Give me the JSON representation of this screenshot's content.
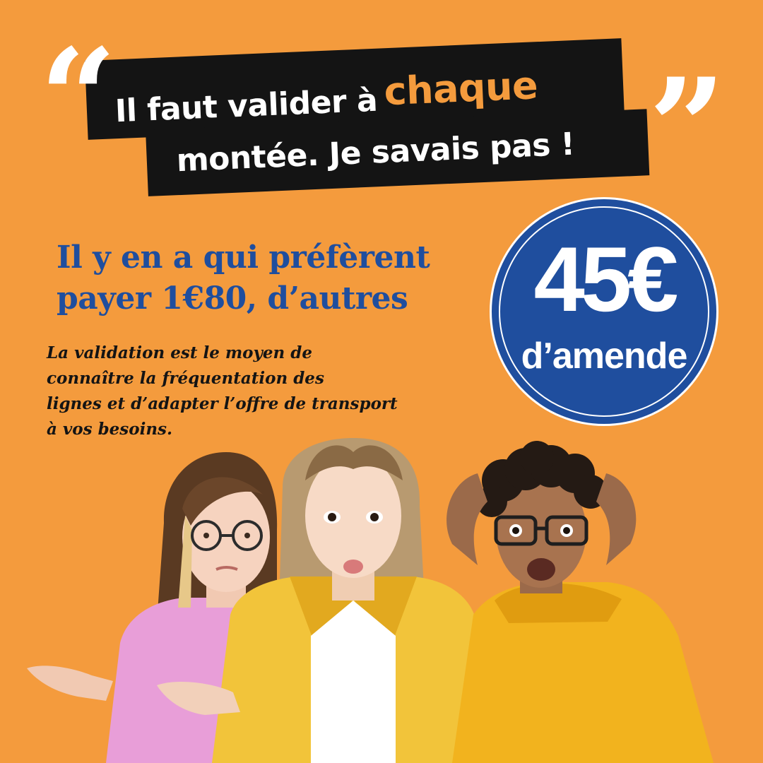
{
  "quote": {
    "open_mark": "“",
    "close_mark": "”",
    "line1_prefix": "Il faut valider à",
    "line1_highlight": "chaque",
    "line2": "montée. Je savais pas !"
  },
  "heading": {
    "line1": "Il y en a qui préfèrent",
    "line2": "payer 1€80, d’autres"
  },
  "body": {
    "line1": "La validation est le moyen de",
    "line2": "connaître la fréquentation des",
    "line3": "lignes et d’adapter l’offre de transport",
    "line4": "à vos besoins."
  },
  "badge": {
    "amount": "45€",
    "label": "d’amende"
  },
  "colors": {
    "background": "#f49b3d",
    "strip": "#141414",
    "accent_orange": "#f49b3d",
    "blue": "#1f4e9e",
    "white": "#ffffff",
    "text_dark": "#141414"
  },
  "people": {
    "left": "woman-pink-shirt-glasses-shrugging",
    "center": "woman-yellow-jacket-surprised-shrugging",
    "right": "man-yellow-hoodie-glasses-shocked"
  }
}
